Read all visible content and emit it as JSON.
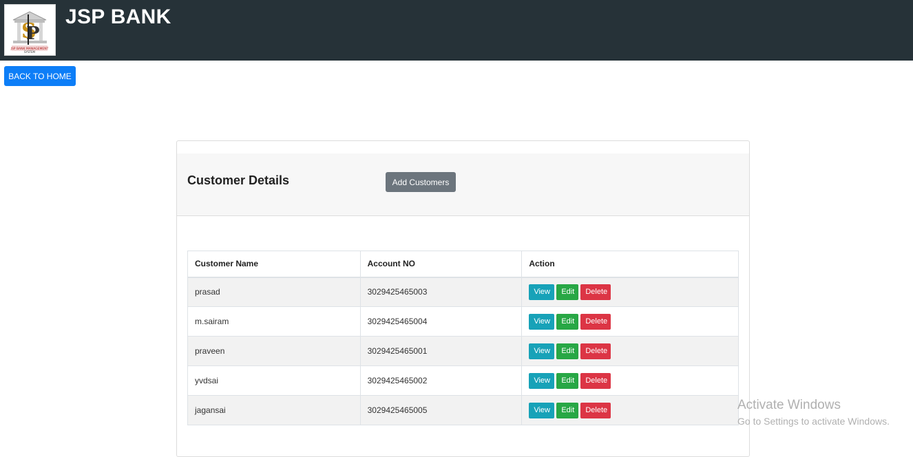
{
  "header": {
    "brand": "JSP BANK",
    "logo_caption": "JSP BANK MANAGEMENT SYSTEM"
  },
  "nav": {
    "back_label": "BACK TO HOME"
  },
  "card": {
    "title": "Customer Details",
    "add_label": "Add Customers"
  },
  "table": {
    "headers": [
      "Customer Name",
      "Account NO",
      "Action"
    ],
    "rows": [
      {
        "name": "prasad",
        "account": "3029425465003"
      },
      {
        "name": "m.sairam",
        "account": "3029425465004"
      },
      {
        "name": "praveen",
        "account": "3029425465001"
      },
      {
        "name": "yvdsai",
        "account": "3029425465002"
      },
      {
        "name": "jagansai",
        "account": "3029425465005"
      }
    ],
    "actions": {
      "view": "View",
      "edit": "Edit",
      "delete": "Delete"
    }
  },
  "watermark": {
    "title": "Activate Windows",
    "subtitle": "Go to Settings to activate Windows."
  },
  "colors": {
    "header_bg": "#263238",
    "primary": "#0d7ef7",
    "secondary": "#6c757d",
    "info": "#17a2b8",
    "success": "#28a745",
    "danger": "#dc3545"
  },
  "icons": {
    "logo": "bank-dollar-logo-icon"
  }
}
